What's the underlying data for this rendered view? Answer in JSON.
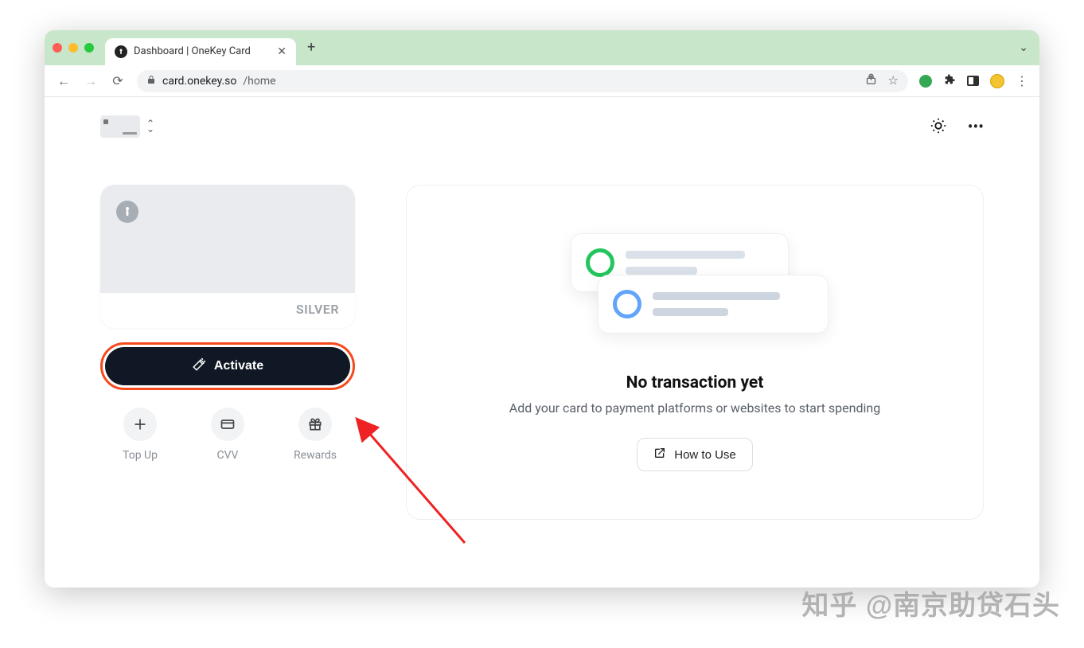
{
  "browser": {
    "tab_title": "Dashboard | OneKey Card",
    "url_host": "card.onekey.so",
    "url_path": "/home"
  },
  "card": {
    "tier": "SILVER"
  },
  "activate": {
    "label": "Activate"
  },
  "actions": {
    "topup": "Top Up",
    "cvv": "CVV",
    "rewards": "Rewards"
  },
  "empty_state": {
    "title": "No transaction yet",
    "subtitle": "Add your card to payment platforms or websites to start spending",
    "howto": "How to Use"
  },
  "watermark": "知乎 @南京助贷石头"
}
